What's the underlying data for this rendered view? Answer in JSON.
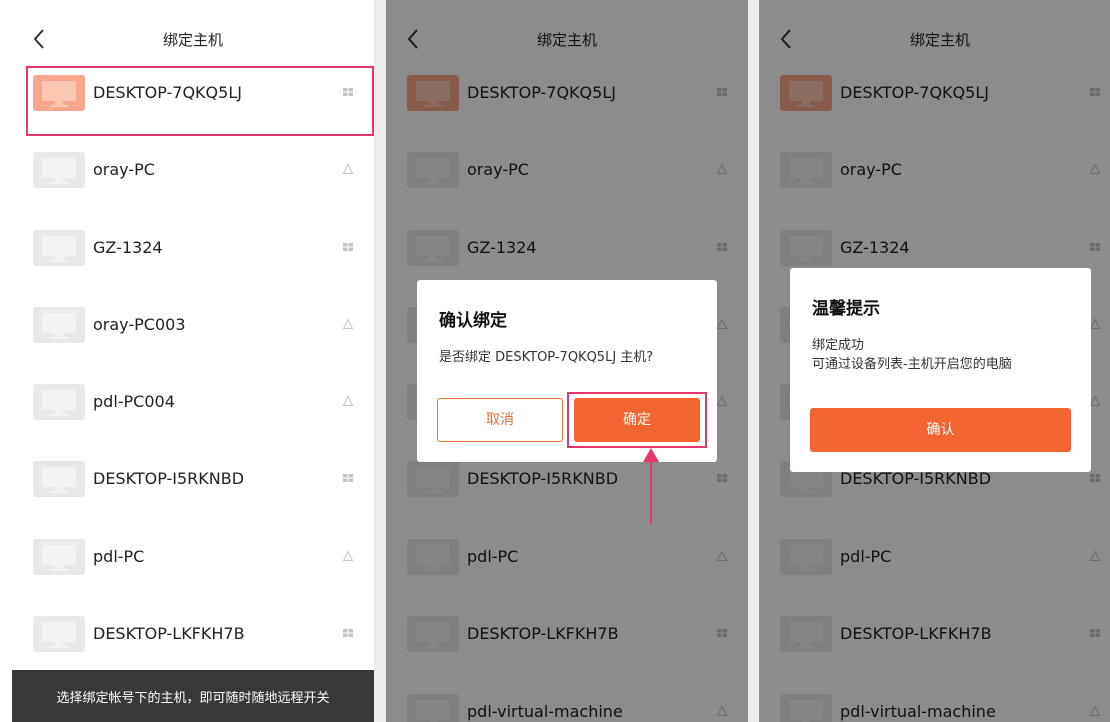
{
  "header": {
    "title": "绑定主机"
  },
  "hosts": [
    {
      "name": "DESKTOP-7QKQ5LJ",
      "os": "windows",
      "selected": true
    },
    {
      "name": "oray-PC",
      "os": "linux"
    },
    {
      "name": "GZ-1324",
      "os": "windows"
    },
    {
      "name": "oray-PC003",
      "os": "linux"
    },
    {
      "name": "pdl-PC004",
      "os": "linux"
    },
    {
      "name": "DESKTOP-I5RKNBD",
      "os": "windows"
    },
    {
      "name": "pdl-PC",
      "os": "linux"
    },
    {
      "name": "DESKTOP-LKFKH7B",
      "os": "windows"
    },
    {
      "name": "pdl-virtual-machine",
      "os": "linux"
    }
  ],
  "footer": {
    "text": "选择绑定帐号下的主机，即可随时随地远程开关"
  },
  "confirm_dialog": {
    "title": "确认绑定",
    "message": "是否绑定 DESKTOP-7QKQ5LJ 主机?",
    "cancel_label": "取消",
    "ok_label": "确定"
  },
  "tip_dialog": {
    "title": "温馨提示",
    "line1": "绑定成功",
    "line2": "可通过设备列表-主机开启您的电脑",
    "ack_label": "确认"
  },
  "colors": {
    "accent": "#f26530",
    "highlight": "#e8356a",
    "thumb_selected": "#f7a88b",
    "thumb_default": "#e8e8e8"
  }
}
